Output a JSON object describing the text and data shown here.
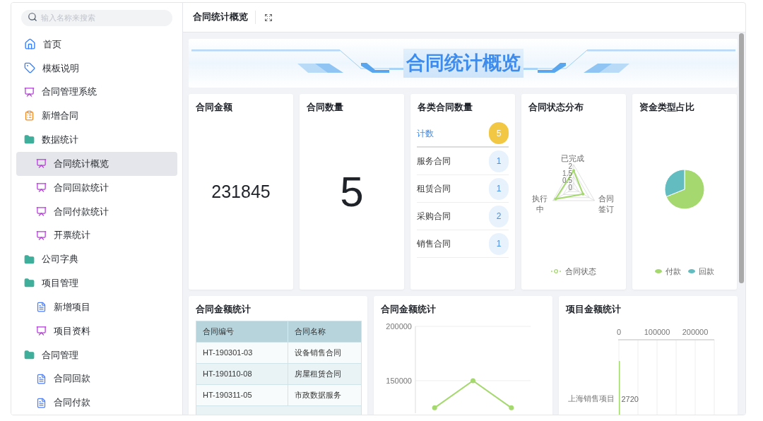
{
  "search": {
    "placeholder": "输入名称来搜索"
  },
  "sidebar": {
    "items": [
      {
        "label": "首页",
        "kind": "home",
        "selected": false
      },
      {
        "label": "模板说明",
        "kind": "tag",
        "selected": false
      },
      {
        "label": "合同管理系统",
        "kind": "monitor",
        "selected": false
      },
      {
        "label": "新增合同",
        "kind": "clipboard",
        "selected": false
      },
      {
        "label": "数据统计",
        "kind": "folder",
        "selected": false,
        "children": [
          {
            "label": "合同统计概览",
            "kind": "monitor",
            "selected": true
          },
          {
            "label": "合同回款统计",
            "kind": "monitor",
            "selected": false
          },
          {
            "label": "合同付款统计",
            "kind": "monitor",
            "selected": false
          },
          {
            "label": "开票统计",
            "kind": "monitor",
            "selected": false
          }
        ]
      },
      {
        "label": "公司字典",
        "kind": "folder",
        "selected": false
      },
      {
        "label": "项目管理",
        "kind": "folder",
        "selected": false,
        "children": [
          {
            "label": "新增项目",
            "kind": "doc",
            "selected": false
          },
          {
            "label": "项目资料",
            "kind": "monitor",
            "selected": false
          }
        ]
      },
      {
        "label": "合同管理",
        "kind": "folder",
        "selected": false,
        "children": [
          {
            "label": "合同回款",
            "kind": "doc",
            "selected": false
          },
          {
            "label": "合同付款",
            "kind": "doc",
            "selected": false
          }
        ]
      }
    ]
  },
  "header": {
    "title": "合同统计概览"
  },
  "banner": {
    "title": "合同统计概览"
  },
  "amount_card": {
    "title": "合同金额",
    "value": "231845"
  },
  "count_card": {
    "title": "合同数量",
    "value": "5"
  },
  "type_card": {
    "title": "各类合同数量",
    "rows": [
      {
        "kind": "total",
        "label": "计数",
        "count": "5"
      },
      {
        "kind": "item",
        "label": "服务合同",
        "count": "1"
      },
      {
        "kind": "item",
        "label": "租赁合同",
        "count": "1"
      },
      {
        "kind": "item",
        "label": "采购合同",
        "count": "2"
      },
      {
        "kind": "item",
        "label": "销售合同",
        "count": "1"
      }
    ]
  },
  "status_card": {
    "title": "合同状态分布",
    "axes": [
      "已完成",
      "合同签订",
      "执行中"
    ],
    "ticks": [
      "2",
      "1.5",
      "0.5",
      "0"
    ],
    "legend": {
      "label": "合同状态",
      "color": "#a5d86f"
    }
  },
  "fund_card": {
    "title": "资金类型占比",
    "legend": [
      {
        "label": "付款",
        "color": "#a5d86f"
      },
      {
        "label": "回款",
        "color": "#62bcc0"
      }
    ]
  },
  "table_card": {
    "title": "合同金额统计",
    "columns": [
      "合同编号",
      "合同名称"
    ],
    "rows": [
      [
        "HT-190301-03",
        "设备销售合同"
      ],
      [
        "HT-190110-08",
        "房屋租赁合同"
      ],
      [
        "HT-190311-05",
        "市政数据服务"
      ]
    ]
  },
  "line_card": {
    "title": "合同金额统计",
    "chart_data": {
      "type": "line",
      "yticks": [
        150000,
        200000
      ],
      "ylim": [
        120000,
        200000
      ],
      "series": [
        {
          "color": "#a5d86f",
          "marker": "circle",
          "values": [
            125000,
            150000,
            125000
          ]
        }
      ]
    }
  },
  "bar_card": {
    "title": "项目金额统计",
    "chart_data": {
      "type": "bar",
      "orientation": "horizontal",
      "categories": [
        "上海销售项目"
      ],
      "xticks": [
        0,
        100000,
        200000
      ],
      "xlim": [
        0,
        250000
      ],
      "data_labels": true,
      "series": [
        {
          "color": "#a5d86f",
          "values": [
            2720
          ]
        }
      ]
    }
  }
}
